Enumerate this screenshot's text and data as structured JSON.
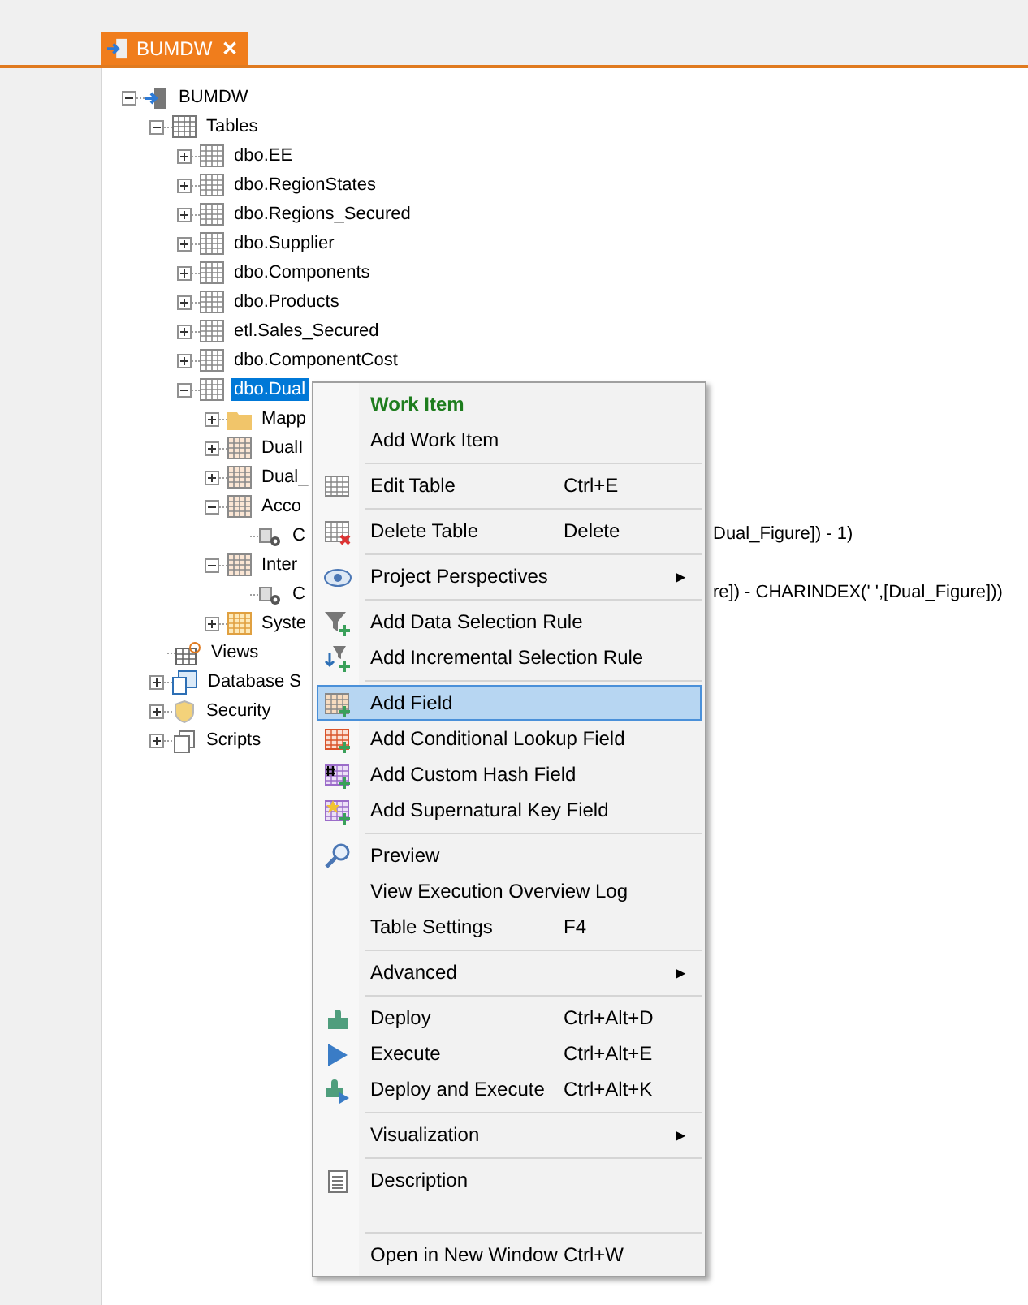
{
  "tab": {
    "title": "BUMDW",
    "close": "✕"
  },
  "tree": [
    {
      "label": "BUMDW",
      "kind": "database",
      "expanded": true,
      "selected": false,
      "children": [
        {
          "label": "Tables",
          "kind": "tables",
          "expanded": true,
          "selected": false,
          "children": [
            {
              "label": "dbo.EE",
              "kind": "table",
              "expanded": false,
              "selected": false
            },
            {
              "label": "dbo.RegionStates",
              "kind": "table",
              "expanded": false,
              "selected": false
            },
            {
              "label": "dbo.Regions_Secured",
              "kind": "table",
              "expanded": false,
              "selected": false
            },
            {
              "label": "dbo.Supplier",
              "kind": "table",
              "expanded": false,
              "selected": false
            },
            {
              "label": "dbo.Components",
              "kind": "table",
              "expanded": false,
              "selected": false
            },
            {
              "label": "dbo.Products",
              "kind": "table",
              "expanded": false,
              "selected": false
            },
            {
              "label": "etl.Sales_Secured",
              "kind": "table",
              "expanded": false,
              "selected": false
            },
            {
              "label": "dbo.ComponentCost",
              "kind": "table",
              "expanded": false,
              "selected": false
            },
            {
              "label": "dbo.Dual",
              "kind": "table",
              "expanded": true,
              "selected": true,
              "children": [
                {
                  "label": "Mapp",
                  "kind": "folder",
                  "expanded": false,
                  "selected": false
                },
                {
                  "label": "DualI",
                  "kind": "field-table",
                  "expanded": false,
                  "selected": false
                },
                {
                  "label": "Dual_",
                  "kind": "field-table",
                  "expanded": false,
                  "selected": false
                },
                {
                  "label": "Acco",
                  "kind": "field-table",
                  "expanded": true,
                  "selected": false,
                  "children": [
                    {
                      "label": "C",
                      "kind": "expression",
                      "selected": false,
                      "expression": "Dual_Figure]) - 1)"
                    }
                  ]
                },
                {
                  "label": "Inter",
                  "kind": "field-table",
                  "expanded": true,
                  "selected": false,
                  "children": [
                    {
                      "label": "C",
                      "kind": "expression",
                      "selected": false,
                      "expression": "re]) - CHARINDEX(' ',[Dual_Figure]))"
                    }
                  ]
                },
                {
                  "label": "Syste",
                  "kind": "system-table",
                  "expanded": false,
                  "selected": false
                }
              ]
            }
          ]
        },
        {
          "label": "Views",
          "kind": "views",
          "selected": false
        },
        {
          "label": "Database S",
          "kind": "schema",
          "expanded": false,
          "selected": false
        },
        {
          "label": "Security",
          "kind": "security",
          "expanded": false,
          "selected": false
        },
        {
          "label": "Scripts",
          "kind": "scripts",
          "expanded": false,
          "selected": false
        }
      ]
    }
  ],
  "context_menu": [
    [
      {
        "kind": "header",
        "label": "Work Item"
      },
      {
        "kind": "item",
        "label": "Add Work Item",
        "selected": false
      }
    ],
    [
      {
        "kind": "item",
        "label": "Edit Table",
        "shortcut": "Ctrl+E",
        "selected": false
      }
    ],
    [
      {
        "kind": "item",
        "label": "Delete Table",
        "shortcut": "Delete",
        "selected": false
      }
    ],
    [
      {
        "kind": "submenu",
        "label": "Project Perspectives",
        "arrow": "▶",
        "selected": false
      }
    ],
    [
      {
        "kind": "item",
        "label": "Add Data Selection Rule",
        "selected": false
      },
      {
        "kind": "item",
        "label": "Add Incremental Selection Rule",
        "selected": false
      }
    ],
    [
      {
        "kind": "item",
        "label": "Add Field",
        "selected": true
      },
      {
        "kind": "item",
        "label": "Add Conditional Lookup Field",
        "selected": false
      },
      {
        "kind": "item",
        "label": "Add Custom Hash Field",
        "selected": false
      },
      {
        "kind": "item",
        "label": "Add Supernatural Key Field",
        "selected": false
      }
    ],
    [
      {
        "kind": "item",
        "label": "Preview",
        "selected": false
      },
      {
        "kind": "item",
        "label": "View Execution Overview Log",
        "selected": false
      },
      {
        "kind": "item",
        "label": "Table Settings",
        "shortcut": "F4",
        "selected": false
      }
    ],
    [
      {
        "kind": "submenu",
        "label": "Advanced",
        "arrow": "▶",
        "selected": false
      }
    ],
    [
      {
        "kind": "item",
        "label": "Deploy",
        "shortcut": "Ctrl+Alt+D",
        "selected": false
      },
      {
        "kind": "item",
        "label": "Execute",
        "shortcut": "Ctrl+Alt+E",
        "selected": false
      },
      {
        "kind": "item",
        "label": "Deploy and Execute",
        "shortcut": "Ctrl+Alt+K",
        "selected": false
      }
    ],
    [
      {
        "kind": "submenu",
        "label": "Visualization",
        "arrow": "▶",
        "selected": false
      }
    ],
    [
      {
        "kind": "item",
        "label": "Description",
        "selected": false
      },
      {
        "kind": "spacer"
      }
    ],
    [
      {
        "kind": "item",
        "label": "Open in New Window",
        "shortcut": "Ctrl+W",
        "selected": false
      }
    ]
  ]
}
